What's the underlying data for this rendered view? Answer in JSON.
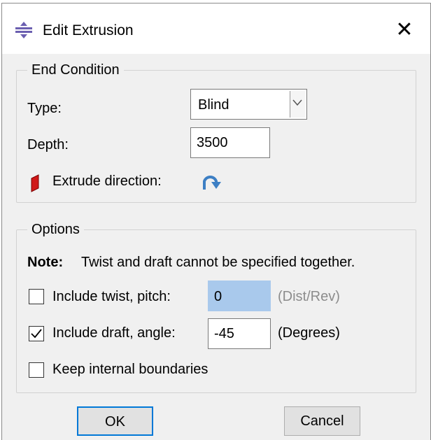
{
  "dialog": {
    "title": "Edit Extrusion",
    "close_glyph": "✕"
  },
  "end_condition": {
    "group_label": "End Condition",
    "type_label": "Type:",
    "type_value": "Blind",
    "depth_label": "Depth:",
    "depth_value": "3500",
    "direction_label": "Extrude direction:"
  },
  "options": {
    "group_label": "Options",
    "note_label": "Note:",
    "note_text": "Twist and draft cannot be specified together.",
    "twist": {
      "label": "Include twist, pitch:",
      "checked": false,
      "value": "0",
      "unit": "(Dist/Rev)"
    },
    "draft": {
      "label": "Include draft, angle:",
      "checked": true,
      "value": "-45",
      "unit": "(Degrees)"
    },
    "internal": {
      "label": "Keep internal boundaries",
      "checked": false
    }
  },
  "buttons": {
    "ok": "OK",
    "cancel": "Cancel"
  },
  "icons": {
    "title": "extrude-dialog-icon",
    "direction_face": "red-face-icon",
    "flip": "flip-arrow-icon",
    "accent": "#3d7fc4"
  }
}
